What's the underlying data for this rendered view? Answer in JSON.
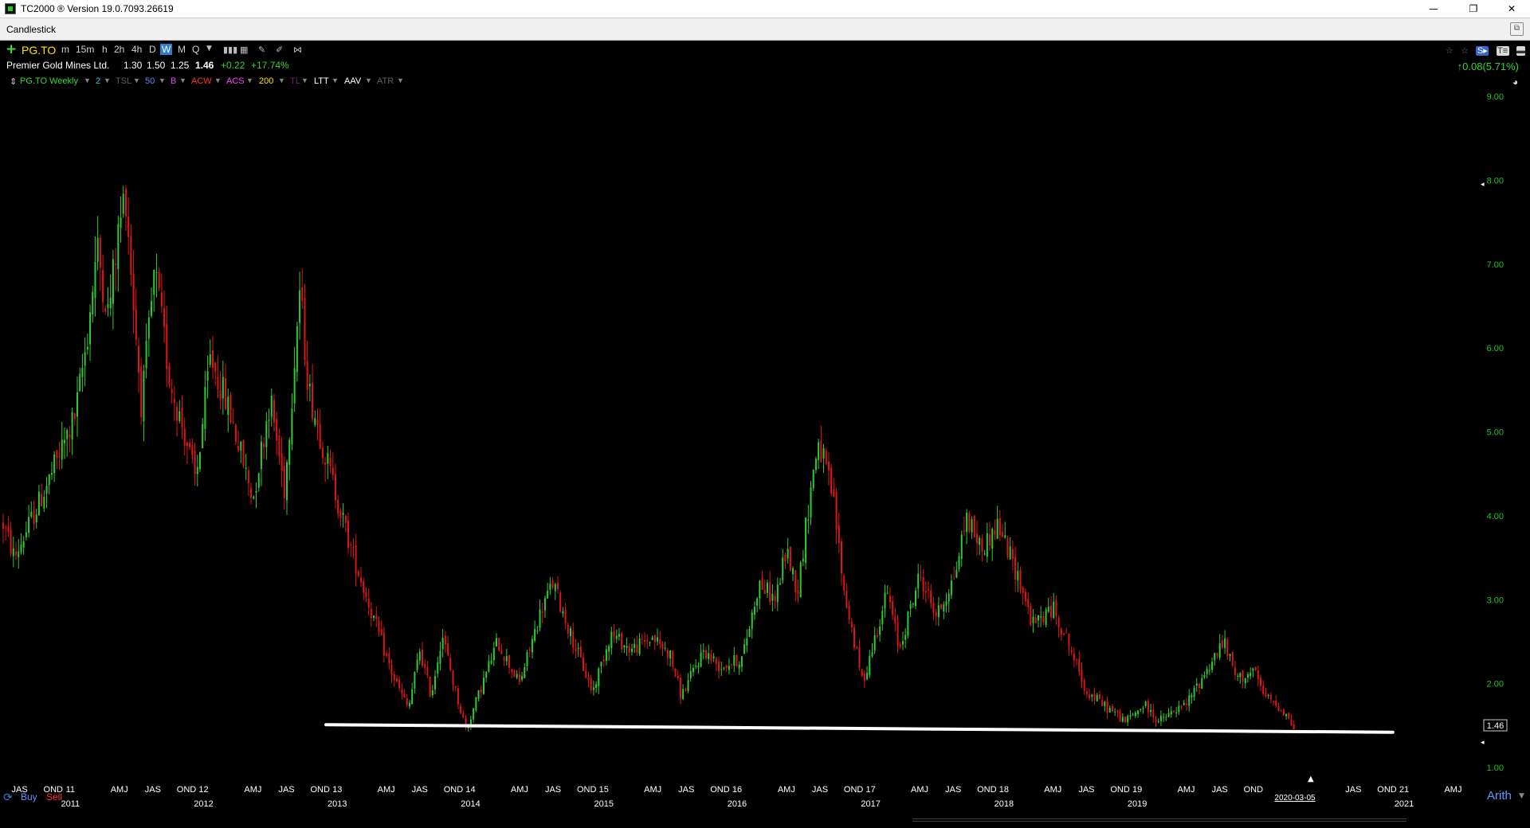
{
  "titlebar": {
    "title": "TC2000 ® Version 19.0.7093.26619",
    "minimize": "—",
    "maximize": "❐",
    "close": "✕"
  },
  "panel": {
    "title": "Candlestick",
    "restore_icon": "⧉"
  },
  "toolbar": {
    "symbol": "PG.TO",
    "timeframes": [
      "m",
      "15m",
      "h",
      "2h",
      "4h",
      "D",
      "W",
      "M",
      "Q"
    ],
    "selected_timeframe": "W",
    "dropdown": "▼"
  },
  "quote": {
    "name": "Premier Gold Mines Ltd.",
    "open": "1.30",
    "high": "1.50",
    "low": "1.25",
    "last": "1.46",
    "change": "+0.22",
    "change_pct": "+17.74%",
    "right_change": "↑0.08(5.71%)"
  },
  "indicators": [
    {
      "label": "PG.TO Weekly",
      "color": "#31d931"
    },
    {
      "label": "2",
      "color": "#2fc0f0"
    },
    {
      "label": "TSL",
      "color": "#5f5f5f"
    },
    {
      "label": "50",
      "color": "#5c8cff"
    },
    {
      "label": "B",
      "color": "#e04bff"
    },
    {
      "label": "ACW",
      "color": "#ff3030"
    },
    {
      "label": "ACS",
      "color": "#ff44ff"
    },
    {
      "label": "200",
      "color": "#ffe600"
    },
    {
      "label": "TL",
      "color": "#6a2a6a"
    },
    {
      "label": "LTT",
      "color": "#ffffff"
    },
    {
      "label": "AAV",
      "color": "#ffffff"
    },
    {
      "label": "ATR",
      "color": "#5f5f5f"
    }
  ],
  "colors": {
    "up": "#2ecc2e",
    "down": "#e01515",
    "axis_text": "#22c322",
    "background": "#000000",
    "trendline": "#ffffff",
    "date_text": "#ffffff"
  },
  "chart_data": {
    "type": "candlestick",
    "symbol": "PG.TO",
    "period": "Weekly",
    "scale": "Arith",
    "last_price": "1.46",
    "ylim": [
      1.0,
      9.0
    ],
    "y_ticks": [
      "9.00",
      "8.00",
      "7.00",
      "6.00",
      "5.00",
      "4.00",
      "3.00",
      "2.00",
      "1.00"
    ],
    "x_start": "2010-07-01",
    "x_end": "2021-07-01",
    "date_label": "2020-03-05",
    "month_marks": [
      {
        "label": "JAS",
        "date": "2010-08-15"
      },
      {
        "label": "OND",
        "date": "2010-11-15"
      },
      {
        "label": "11",
        "date": "2011-01-01"
      },
      {
        "label": "AMJ",
        "date": "2011-05-15"
      },
      {
        "label": "JAS",
        "date": "2011-08-15"
      },
      {
        "label": "OND",
        "date": "2011-11-15"
      },
      {
        "label": "12",
        "date": "2012-01-01"
      },
      {
        "label": "AMJ",
        "date": "2012-05-15"
      },
      {
        "label": "JAS",
        "date": "2012-08-15"
      },
      {
        "label": "OND",
        "date": "2012-11-15"
      },
      {
        "label": "13",
        "date": "2013-01-01"
      },
      {
        "label": "AMJ",
        "date": "2013-05-15"
      },
      {
        "label": "JAS",
        "date": "2013-08-15"
      },
      {
        "label": "OND",
        "date": "2013-11-15"
      },
      {
        "label": "14",
        "date": "2014-01-01"
      },
      {
        "label": "AMJ",
        "date": "2014-05-15"
      },
      {
        "label": "JAS",
        "date": "2014-08-15"
      },
      {
        "label": "OND",
        "date": "2014-11-15"
      },
      {
        "label": "15",
        "date": "2015-01-01"
      },
      {
        "label": "AMJ",
        "date": "2015-05-15"
      },
      {
        "label": "JAS",
        "date": "2015-08-15"
      },
      {
        "label": "OND",
        "date": "2015-11-15"
      },
      {
        "label": "16",
        "date": "2016-01-01"
      },
      {
        "label": "AMJ",
        "date": "2016-05-15"
      },
      {
        "label": "JAS",
        "date": "2016-08-15"
      },
      {
        "label": "OND",
        "date": "2016-11-15"
      },
      {
        "label": "17",
        "date": "2017-01-01"
      },
      {
        "label": "AMJ",
        "date": "2017-05-15"
      },
      {
        "label": "JAS",
        "date": "2017-08-15"
      },
      {
        "label": "OND",
        "date": "2017-11-15"
      },
      {
        "label": "18",
        "date": "2018-01-01"
      },
      {
        "label": "AMJ",
        "date": "2018-05-15"
      },
      {
        "label": "JAS",
        "date": "2018-08-15"
      },
      {
        "label": "OND",
        "date": "2018-11-15"
      },
      {
        "label": "19",
        "date": "2019-01-01"
      },
      {
        "label": "AMJ",
        "date": "2019-05-15"
      },
      {
        "label": "JAS",
        "date": "2019-08-15"
      },
      {
        "label": "OND",
        "date": "2019-11-15"
      },
      {
        "label": "JAS",
        "date": "2020-08-15"
      },
      {
        "label": "OND",
        "date": "2020-11-15"
      },
      {
        "label": "21",
        "date": "2021-01-01"
      },
      {
        "label": "AMJ",
        "date": "2021-05-15"
      },
      {
        "label": "JAS",
        "date": "2021-08-15"
      }
    ],
    "year_marks": [
      {
        "label": "2011",
        "date": "2011-01-01"
      },
      {
        "label": "2012",
        "date": "2012-01-01"
      },
      {
        "label": "2013",
        "date": "2013-01-01"
      },
      {
        "label": "2014",
        "date": "2014-01-01"
      },
      {
        "label": "2015",
        "date": "2015-01-01"
      },
      {
        "label": "2016",
        "date": "2016-01-01"
      },
      {
        "label": "2017",
        "date": "2017-01-01"
      },
      {
        "label": "2018",
        "date": "2018-01-01"
      },
      {
        "label": "2019",
        "date": "2019-01-01"
      },
      {
        "label": "2021",
        "date": "2021-01-01"
      }
    ],
    "trendline": {
      "start": {
        "date": "2012-12-01",
        "price": 1.51
      },
      "end": {
        "date": "2020-12-01",
        "price": 1.42
      }
    },
    "price_path": [
      {
        "date": "2010-07-01",
        "price": 3.9
      },
      {
        "date": "2010-08-01",
        "price": 3.5
      },
      {
        "date": "2010-11-01",
        "price": 4.4
      },
      {
        "date": "2011-01-15",
        "price": 5.2
      },
      {
        "date": "2011-02-15",
        "price": 6.1
      },
      {
        "date": "2011-03-15",
        "price": 7.2
      },
      {
        "date": "2011-04-15",
        "price": 6.4
      },
      {
        "date": "2011-05-10",
        "price": 7.3
      },
      {
        "date": "2011-06-01",
        "price": 7.9
      },
      {
        "date": "2011-06-20",
        "price": 6.7
      },
      {
        "date": "2011-07-15",
        "price": 5.3
      },
      {
        "date": "2011-08-20",
        "price": 6.9
      },
      {
        "date": "2011-10-01",
        "price": 5.6
      },
      {
        "date": "2011-11-15",
        "price": 4.9
      },
      {
        "date": "2011-12-10",
        "price": 4.4
      },
      {
        "date": "2012-01-20",
        "price": 5.9
      },
      {
        "date": "2012-03-15",
        "price": 5.2
      },
      {
        "date": "2012-05-15",
        "price": 4.2
      },
      {
        "date": "2012-07-01",
        "price": 5.4
      },
      {
        "date": "2012-08-10",
        "price": 4.3
      },
      {
        "date": "2012-09-20",
        "price": 6.7
      },
      {
        "date": "2012-10-15",
        "price": 5.5
      },
      {
        "date": "2012-12-01",
        "price": 4.7
      },
      {
        "date": "2013-02-01",
        "price": 3.7
      },
      {
        "date": "2013-04-01",
        "price": 2.9
      },
      {
        "date": "2013-06-01",
        "price": 2.1
      },
      {
        "date": "2013-07-15",
        "price": 1.7
      },
      {
        "date": "2013-08-15",
        "price": 2.4
      },
      {
        "date": "2013-09-15",
        "price": 1.85
      },
      {
        "date": "2013-10-15",
        "price": 2.6
      },
      {
        "date": "2013-11-15",
        "price": 2.0
      },
      {
        "date": "2013-12-20",
        "price": 1.45
      },
      {
        "date": "2014-03-15",
        "price": 2.5
      },
      {
        "date": "2014-05-15",
        "price": 2.0
      },
      {
        "date": "2014-07-15",
        "price": 2.9
      },
      {
        "date": "2014-08-15",
        "price": 3.2
      },
      {
        "date": "2014-10-01",
        "price": 2.6
      },
      {
        "date": "2014-12-01",
        "price": 1.9
      },
      {
        "date": "2015-01-20",
        "price": 2.6
      },
      {
        "date": "2015-03-15",
        "price": 2.4
      },
      {
        "date": "2015-05-15",
        "price": 2.55
      },
      {
        "date": "2015-07-01",
        "price": 2.35
      },
      {
        "date": "2015-08-01",
        "price": 1.85
      },
      {
        "date": "2015-10-01",
        "price": 2.4
      },
      {
        "date": "2015-11-15",
        "price": 2.2
      },
      {
        "date": "2016-01-15",
        "price": 2.3
      },
      {
        "date": "2016-03-01",
        "price": 3.2
      },
      {
        "date": "2016-04-15",
        "price": 3.0
      },
      {
        "date": "2016-05-15",
        "price": 3.6
      },
      {
        "date": "2016-06-15",
        "price": 3.1
      },
      {
        "date": "2016-07-20",
        "price": 4.3
      },
      {
        "date": "2016-08-10",
        "price": 4.9
      },
      {
        "date": "2016-09-20",
        "price": 4.2
      },
      {
        "date": "2016-10-20",
        "price": 3.1
      },
      {
        "date": "2016-12-10",
        "price": 2.0
      },
      {
        "date": "2017-02-15",
        "price": 3.1
      },
      {
        "date": "2017-03-20",
        "price": 2.4
      },
      {
        "date": "2017-05-15",
        "price": 3.3
      },
      {
        "date": "2017-07-01",
        "price": 2.8
      },
      {
        "date": "2017-08-20",
        "price": 3.3
      },
      {
        "date": "2017-09-20",
        "price": 4.0
      },
      {
        "date": "2017-11-01",
        "price": 3.6
      },
      {
        "date": "2017-12-15",
        "price": 3.9
      },
      {
        "date": "2018-02-15",
        "price": 3.2
      },
      {
        "date": "2018-03-20",
        "price": 2.7
      },
      {
        "date": "2018-05-15",
        "price": 2.9
      },
      {
        "date": "2018-06-20",
        "price": 2.55
      },
      {
        "date": "2018-08-15",
        "price": 1.9
      },
      {
        "date": "2018-10-15",
        "price": 1.7
      },
      {
        "date": "2018-12-01",
        "price": 1.55
      },
      {
        "date": "2019-01-20",
        "price": 1.75
      },
      {
        "date": "2019-03-01",
        "price": 1.55
      },
      {
        "date": "2019-05-15",
        "price": 1.75
      },
      {
        "date": "2019-07-15",
        "price": 2.2
      },
      {
        "date": "2019-08-25",
        "price": 2.5
      },
      {
        "date": "2019-10-01",
        "price": 2.05
      },
      {
        "date": "2019-11-15",
        "price": 2.15
      },
      {
        "date": "2019-12-15",
        "price": 1.85
      },
      {
        "date": "2020-02-01",
        "price": 1.7
      },
      {
        "date": "2020-02-25",
        "price": 1.55
      },
      {
        "date": "2020-03-05",
        "price": 1.46
      }
    ]
  },
  "bottom": {
    "buy_label": "Buy",
    "sell_label": "Sell",
    "scale_label": "Arith"
  }
}
